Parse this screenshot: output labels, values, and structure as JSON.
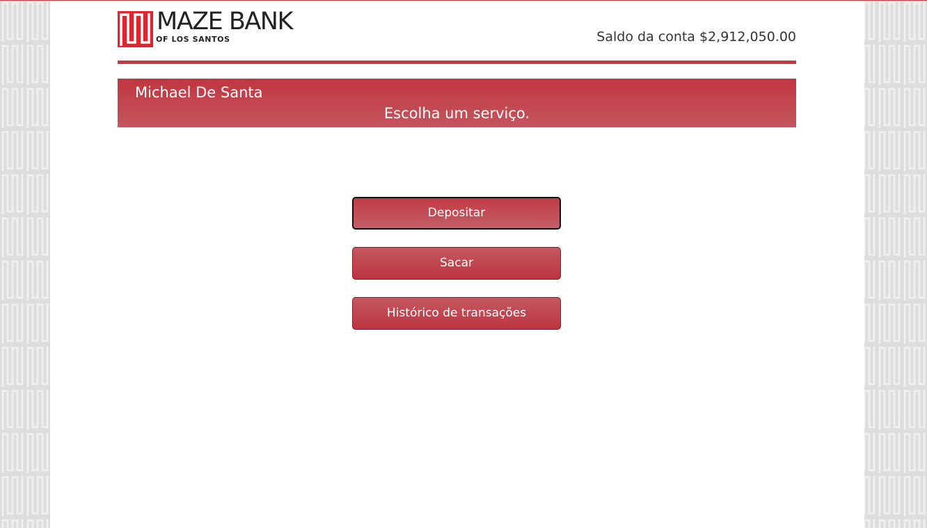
{
  "brand": {
    "name": "MAZE BANK",
    "subtitle": "OF LOS SANTOS",
    "accent_color": "#c63a44",
    "icon": "maze-logo-icon"
  },
  "header": {
    "balance_text": "Saldo da conta $2,912,050.00"
  },
  "banner": {
    "user_name": "Michael De Santa",
    "prompt": "Escolha um serviço."
  },
  "actions": [
    {
      "label": "Depositar"
    },
    {
      "label": "Sacar"
    },
    {
      "label": "Histórico de transações"
    }
  ]
}
